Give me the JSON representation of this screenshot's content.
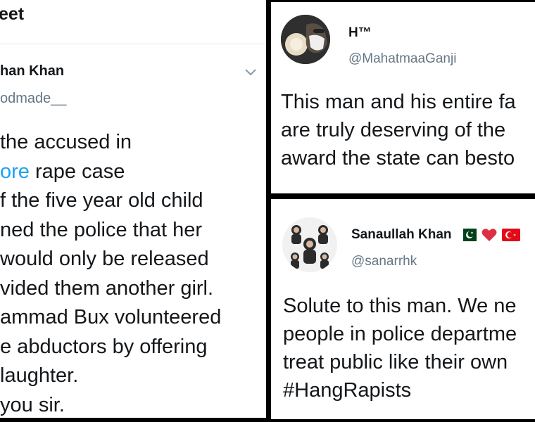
{
  "left_tweet": {
    "header_title": "eet",
    "display_name": "han Khan",
    "handle": "odmade__",
    "text_lines": [
      {
        "pre": "the accused in",
        "link": "",
        "post": ""
      },
      {
        "pre": "",
        "link": "ore",
        "post": " rape case"
      },
      {
        "pre": "f the five year old child",
        "link": "",
        "post": ""
      },
      {
        "pre": "ned the police that her",
        "link": "",
        "post": ""
      },
      {
        "pre": " would only be released",
        "link": "",
        "post": ""
      },
      {
        "pre": "vided them another girl.",
        "link": "",
        "post": ""
      },
      {
        "pre": "ammad Bux volunteered",
        "link": "",
        "post": ""
      },
      {
        "pre": "e abductors by offering",
        "link": "",
        "post": ""
      },
      {
        "pre": "laughter.",
        "link": "",
        "post": ""
      },
      {
        "pre": " you sir.",
        "link": "",
        "post": ""
      }
    ],
    "caret_icon": "chevron-down-icon"
  },
  "top_right_tweet": {
    "display_name": "H™",
    "handle": "@MahatmaaGanji",
    "avatar_icon": "profile-photo",
    "text_lines": [
      "This man and his entire fa",
      "are truly deserving of the",
      "award the state can besto"
    ]
  },
  "bottom_right_tweet": {
    "display_name": "Sanaullah Khan",
    "handle": "@sanarrhk",
    "avatar_icon": "profile-photo",
    "name_emojis": [
      "pakistan-flag-icon",
      "red-heart-icon",
      "turkey-flag-icon"
    ],
    "text_lines": [
      "Solute to this man. We ne",
      "people in police departme",
      "treat public like their own"
    ],
    "hashtag": "#HangRapists"
  },
  "colors": {
    "text": "#14171a",
    "secondary": "#657786",
    "link": "#1da1f2",
    "separator": "#000000"
  }
}
